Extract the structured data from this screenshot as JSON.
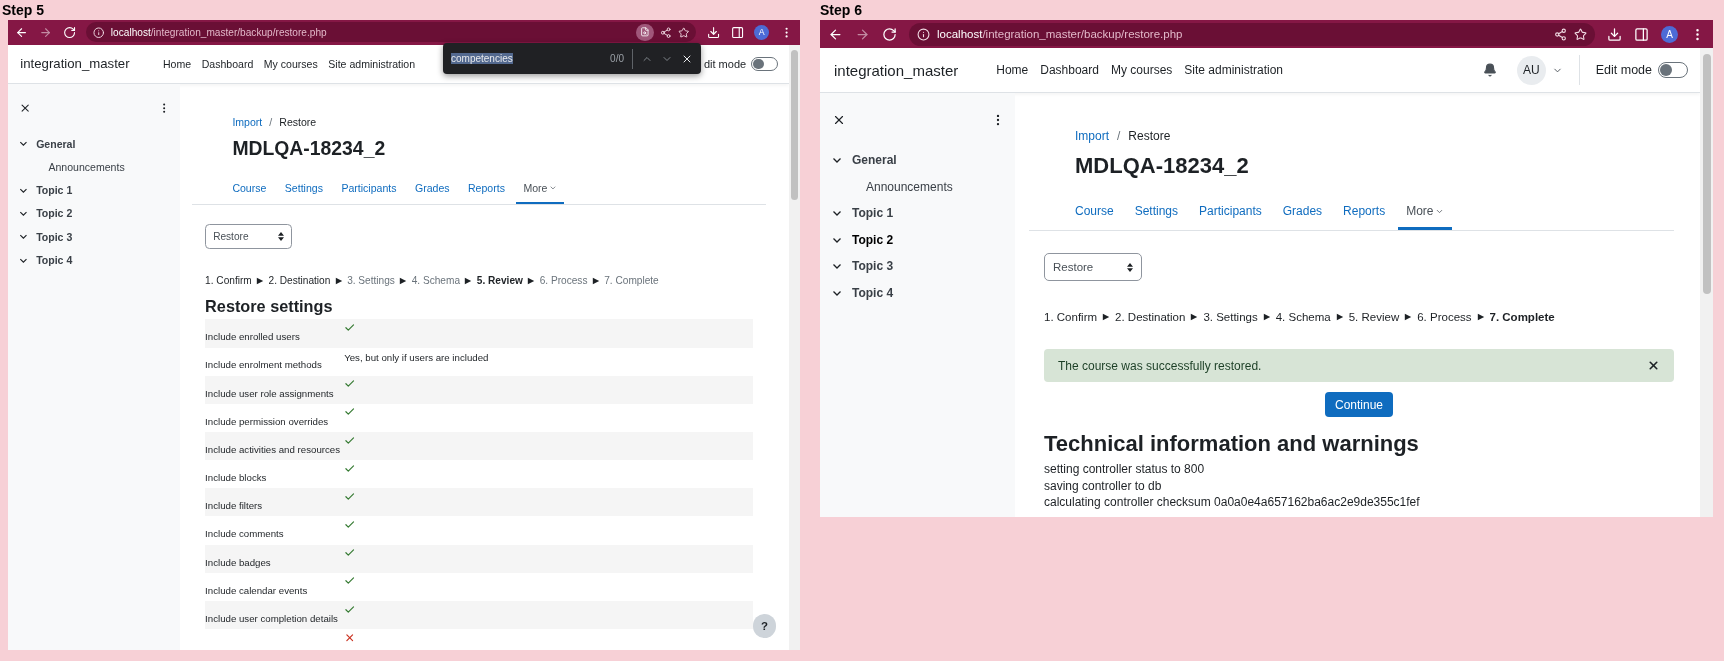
{
  "panels": [
    {
      "caption": "Step 5",
      "browser": {
        "url_host": "localhost",
        "url_path": "/integration_master/backup/restore.php",
        "profile_initial": "A"
      },
      "find_bar": {
        "query": "competencies",
        "count": "0/0"
      },
      "navbar": {
        "brand": "integration_master",
        "links": [
          "Home",
          "Dashboard",
          "My courses",
          "Site administration"
        ],
        "edit_mode": {
          "label": "dit mode",
          "on": false
        }
      },
      "sidebar": {
        "sections": [
          {
            "title": "General",
            "expanded": true,
            "selected": false,
            "children": [
              {
                "label": "Announcements"
              }
            ]
          },
          {
            "title": "Topic 1",
            "expanded": true,
            "selected": false
          },
          {
            "title": "Topic 2",
            "expanded": true,
            "selected": false
          },
          {
            "title": "Topic 3",
            "expanded": true,
            "selected": false
          },
          {
            "title": "Topic 4",
            "expanded": true,
            "selected": false
          }
        ]
      },
      "page": {
        "breadcrumb": {
          "items": [
            {
              "label": "Import",
              "link": true
            },
            {
              "label": "Restore",
              "link": false
            }
          ],
          "separator": "/"
        },
        "title": "MDLQA-18234_2",
        "tabs": [
          {
            "label": "Course",
            "selected": false,
            "dropdown": false
          },
          {
            "label": "Settings",
            "selected": false,
            "dropdown": false
          },
          {
            "label": "Participants",
            "selected": false,
            "dropdown": false
          },
          {
            "label": "Grades",
            "selected": false,
            "dropdown": false
          },
          {
            "label": "Reports",
            "selected": false,
            "dropdown": false
          },
          {
            "label": "More",
            "selected": true,
            "dropdown": true
          }
        ],
        "select": {
          "value": "Restore"
        },
        "steps": [
          {
            "label": "1. Confirm",
            "current": false,
            "muted": false
          },
          {
            "label": "2. Destination",
            "current": false,
            "muted": false
          },
          {
            "label": "3. Settings",
            "current": false,
            "muted": true
          },
          {
            "label": "4. Schema",
            "current": false,
            "muted": true
          },
          {
            "label": "5. Review",
            "current": true,
            "muted": false
          },
          {
            "label": "6. Process",
            "current": false,
            "muted": true
          },
          {
            "label": "7. Complete",
            "current": false,
            "muted": true
          }
        ],
        "restore_settings": {
          "heading": "Restore settings",
          "rows": [
            {
              "label": "Include enrolled users",
              "kind": "check"
            },
            {
              "label": "Include enrolment methods",
              "kind": "text",
              "value": "Yes, but only if users are included"
            },
            {
              "label": "Include user role assignments",
              "kind": "check"
            },
            {
              "label": "Include permission overrides",
              "kind": "check"
            },
            {
              "label": "Include activities and resources",
              "kind": "check"
            },
            {
              "label": "Include blocks",
              "kind": "check"
            },
            {
              "label": "Include filters",
              "kind": "check"
            },
            {
              "label": "Include comments",
              "kind": "check"
            },
            {
              "label": "Include badges",
              "kind": "check"
            },
            {
              "label": "Include calendar events",
              "kind": "check"
            },
            {
              "label": "Include user completion details",
              "kind": "check"
            },
            {
              "kind": "cross"
            }
          ]
        },
        "help_button": "?"
      }
    },
    {
      "caption": "Step 6",
      "browser": {
        "url_host": "localhost",
        "url_path": "/integration_master/backup/restore.php",
        "profile_initial": "A"
      },
      "navbar": {
        "brand": "integration_master",
        "links": [
          "Home",
          "Dashboard",
          "My courses",
          "Site administration"
        ],
        "user": {
          "initials": "AU"
        },
        "edit_mode": {
          "label": "Edit mode",
          "on": false
        }
      },
      "sidebar": {
        "sections": [
          {
            "title": "General",
            "expanded": true,
            "selected": false,
            "children": [
              {
                "label": "Announcements"
              }
            ]
          },
          {
            "title": "Topic 1",
            "expanded": true,
            "selected": false
          },
          {
            "title": "Topic 2",
            "expanded": true,
            "selected": true
          },
          {
            "title": "Topic 3",
            "expanded": true,
            "selected": false
          },
          {
            "title": "Topic 4",
            "expanded": true,
            "selected": false
          }
        ]
      },
      "page": {
        "breadcrumb": {
          "items": [
            {
              "label": "Import",
              "link": true
            },
            {
              "label": "Restore",
              "link": false
            }
          ],
          "separator": "/"
        },
        "title": "MDLQA-18234_2",
        "tabs": [
          {
            "label": "Course",
            "selected": false,
            "dropdown": false
          },
          {
            "label": "Settings",
            "selected": false,
            "dropdown": false
          },
          {
            "label": "Participants",
            "selected": false,
            "dropdown": false
          },
          {
            "label": "Grades",
            "selected": false,
            "dropdown": false
          },
          {
            "label": "Reports",
            "selected": false,
            "dropdown": false
          },
          {
            "label": "More",
            "selected": true,
            "dropdown": true
          }
        ],
        "select": {
          "value": "Restore"
        },
        "steps": [
          {
            "label": "1. Confirm",
            "current": false,
            "muted": false
          },
          {
            "label": "2. Destination",
            "current": false,
            "muted": false
          },
          {
            "label": "3. Settings",
            "current": false,
            "muted": false
          },
          {
            "label": "4. Schema",
            "current": false,
            "muted": false
          },
          {
            "label": "5. Review",
            "current": false,
            "muted": false
          },
          {
            "label": "6. Process",
            "current": false,
            "muted": false
          },
          {
            "label": "7. Complete",
            "current": true,
            "muted": false
          }
        ],
        "alert": {
          "kind": "success",
          "message": "The course was successfully restored."
        },
        "continue_button": "Continue",
        "technical": {
          "heading": "Technical information and warnings",
          "lines": [
            "setting controller status to 800",
            "saving controller to db",
            "calculating controller checksum 0a0a0e4a657162ba6ac2e9de355c1fef"
          ]
        }
      }
    }
  ]
}
